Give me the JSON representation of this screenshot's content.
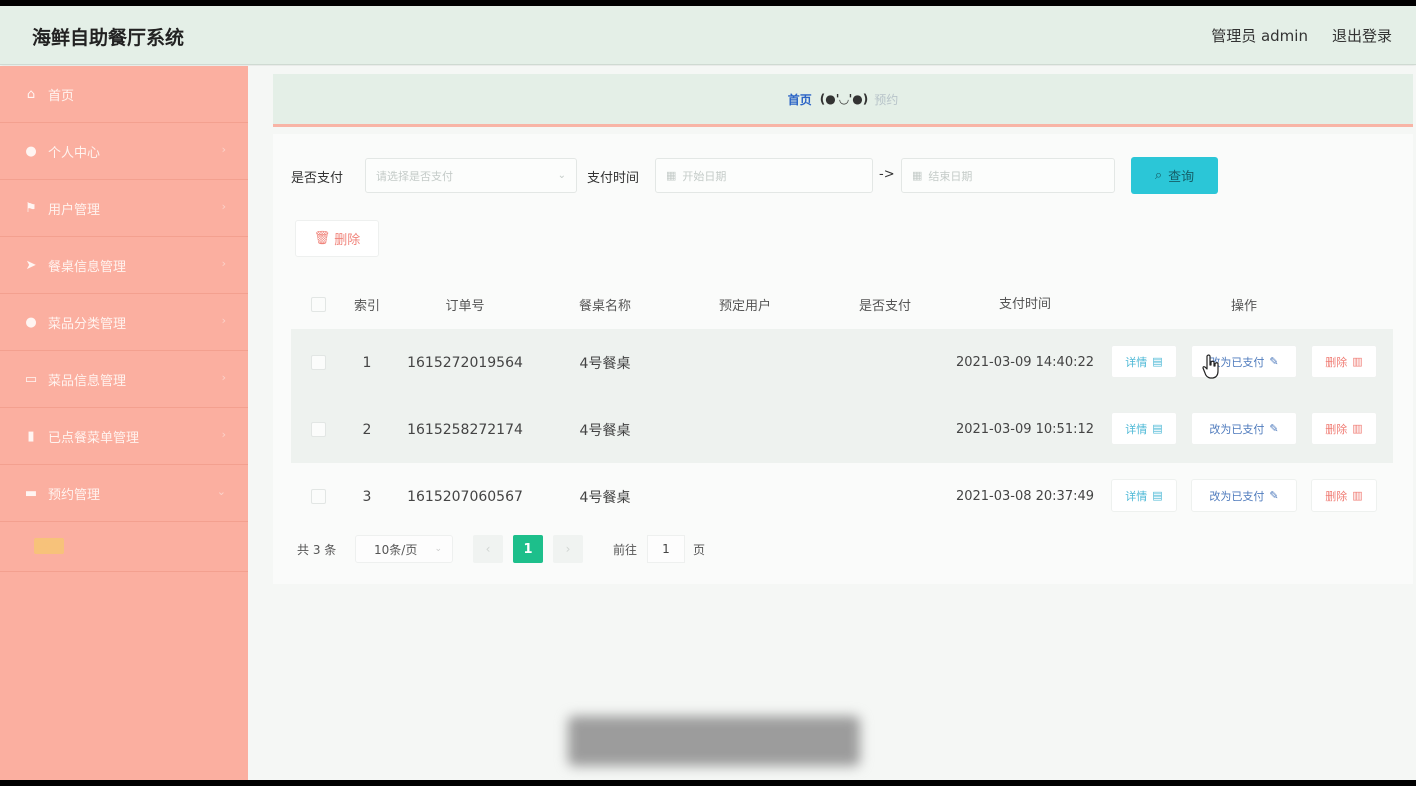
{
  "header": {
    "app_title": "海鲜自助餐厅系统",
    "user_label": "管理员 admin",
    "logout_label": "退出登录"
  },
  "sidebar": {
    "items": [
      {
        "label": "首页",
        "icon": "home-icon",
        "glyph": "⌂"
      },
      {
        "label": "个人中心",
        "icon": "user-icon",
        "glyph": "●"
      },
      {
        "label": "用户管理",
        "icon": "flag-icon",
        "glyph": "⚑"
      },
      {
        "label": "餐桌信息管理",
        "icon": "send-icon",
        "glyph": "➤"
      },
      {
        "label": "菜品分类管理",
        "icon": "person-icon",
        "glyph": "●"
      },
      {
        "label": "菜品信息管理",
        "icon": "card-icon",
        "glyph": "▭"
      },
      {
        "label": "已点餐菜单管理",
        "icon": "bar-chart-icon",
        "glyph": "▮"
      },
      {
        "label": "预约管理",
        "icon": "folder-icon",
        "glyph": "▬"
      }
    ],
    "arrow_glyph": "›",
    "open_arrow_glyph": "⌄"
  },
  "breadcrumb": {
    "home": "首页",
    "face": "(●'◡'●)",
    "sub": "预约"
  },
  "search": {
    "paid_label": "是否支付",
    "paid_placeholder": "请选择是否支付",
    "time_label": "支付时间",
    "start_placeholder": "开始日期",
    "end_placeholder": "结束日期",
    "range_sep": "->",
    "query_button": "查询",
    "calendar_glyph": "▦",
    "caret_glyph": "⌄",
    "search_glyph": "⌕"
  },
  "toolbar": {
    "delete_button": "删除",
    "trash_glyph": "🗑"
  },
  "table": {
    "columns": {
      "index": "索引",
      "order_no": "订单号",
      "table_name": "餐桌名称",
      "user": "预定用户",
      "paid": "是否支付",
      "pay_time": "支付时间",
      "ops": "操作"
    },
    "rows": [
      {
        "index": "1",
        "order_no": "1615272019564",
        "table_name": "4号餐桌",
        "user": "",
        "paid": "",
        "pay_time": "2021-03-09 14:40:22"
      },
      {
        "index": "2",
        "order_no": "1615258272174",
        "table_name": "4号餐桌",
        "user": "",
        "paid": "",
        "pay_time": "2021-03-09 10:51:12"
      },
      {
        "index": "3",
        "order_no": "1615207060567",
        "table_name": "4号餐桌",
        "user": "",
        "paid": "",
        "pay_time": "2021-03-08 20:37:49"
      }
    ],
    "op_labels": {
      "detail": "详情",
      "mark_paid": "改为已支付",
      "remove": "删除"
    }
  },
  "pagination": {
    "total": "共 3 条",
    "page_size": "10条/页",
    "current": "1",
    "prev_glyph": "‹",
    "next_glyph": "›",
    "goto_label": "前往",
    "goto_value": "1",
    "page_suffix": "页"
  }
}
